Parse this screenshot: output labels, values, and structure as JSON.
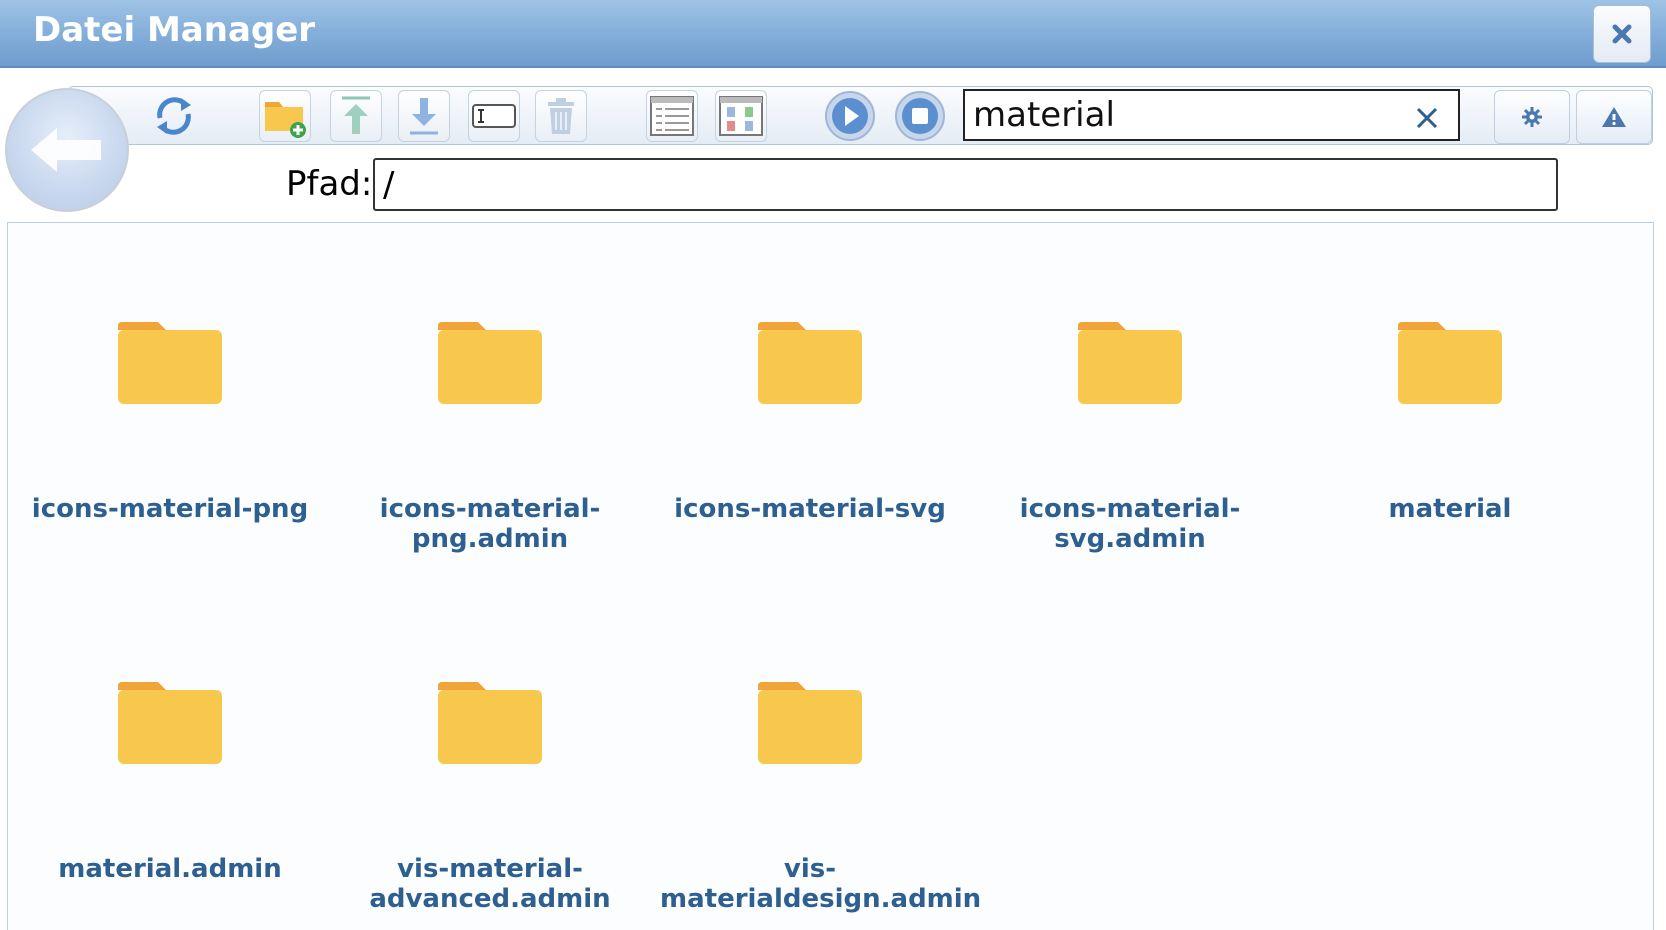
{
  "window": {
    "title": "Datei Manager",
    "close_icon": "close-icon"
  },
  "toolbar": {
    "back_icon": "arrow-left-icon",
    "buttons": [
      {
        "name": "refresh-button",
        "icon": "refresh-icon"
      },
      {
        "name": "new-folder-button",
        "icon": "folder-add-icon"
      },
      {
        "name": "upload-button",
        "icon": "upload-icon"
      },
      {
        "name": "download-button",
        "icon": "download-icon"
      },
      {
        "name": "rename-button",
        "icon": "rename-icon"
      },
      {
        "name": "delete-button",
        "icon": "trash-icon"
      },
      {
        "name": "list-view-button",
        "icon": "list-view-icon"
      },
      {
        "name": "grid-view-button",
        "icon": "grid-view-icon"
      },
      {
        "name": "play-button",
        "icon": "play-icon"
      },
      {
        "name": "stop-button",
        "icon": "stop-icon"
      },
      {
        "name": "settings-button",
        "icon": "gear-icon"
      },
      {
        "name": "warning-button",
        "icon": "warning-icon"
      }
    ]
  },
  "search": {
    "value": "material",
    "clear_icon": "clear-icon"
  },
  "path": {
    "label": "Pfad:",
    "value": "/"
  },
  "folders": [
    {
      "name": "icons-material-png",
      "line1": "icons-material-png",
      "line2": ""
    },
    {
      "name": "icons-material-png.admin",
      "line1": "icons-material-",
      "line2": "png.admin"
    },
    {
      "name": "icons-material-svg",
      "line1": "icons-material-svg",
      "line2": ""
    },
    {
      "name": "icons-material-svg.admin",
      "line1": "icons-material-",
      "line2": "svg.admin"
    },
    {
      "name": "material",
      "line1": "material",
      "line2": ""
    },
    {
      "name": "material.admin",
      "line1": "material.admin",
      "line2": ""
    },
    {
      "name": "vis-material-advanced.admin",
      "line1": "vis-material-",
      "line2": "advanced.admin"
    },
    {
      "name": "vis-materialdesign.admin",
      "line1": "vis-",
      "line2": "materialdesign.admin"
    }
  ],
  "colors": {
    "titlebar": "#87b1dc",
    "folder": "#f8c84e",
    "folder_tab": "#f0a43a",
    "folder_label": "#2d5f91"
  }
}
